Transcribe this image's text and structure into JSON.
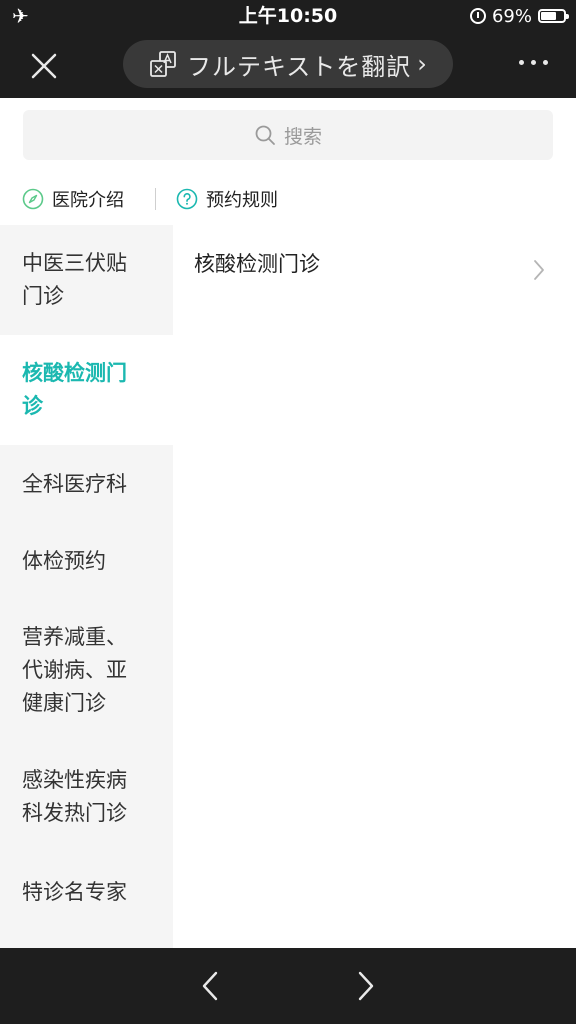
{
  "status_bar": {
    "time": "上午10:50",
    "battery": "69%",
    "battery_level": 0.69
  },
  "nav": {
    "translate_label": "フルテキストを翻訳",
    "translate_chevron": "›"
  },
  "search": {
    "placeholder": "搜索"
  },
  "links": {
    "hospital_intro": "医院介绍",
    "booking_rules": "预约规则"
  },
  "sidebar": {
    "items": [
      {
        "lines": [
          "中医三伏贴",
          "门诊"
        ],
        "active": false
      },
      {
        "lines": [
          "核酸检测门",
          "诊"
        ],
        "active": true
      },
      {
        "lines": [
          "全科医疗科"
        ],
        "active": false
      },
      {
        "lines": [
          "体检预约"
        ],
        "active": false
      },
      {
        "lines": [
          "营养减重、",
          "代谢病、亚",
          "健康门诊"
        ],
        "active": false
      },
      {
        "lines": [
          "感染性疾病",
          "科发热门诊"
        ],
        "active": false
      },
      {
        "lines": [
          "特诊名专家"
        ],
        "active": false
      }
    ]
  },
  "content": {
    "items": [
      {
        "label": "核酸检测门诊"
      }
    ]
  },
  "colors": {
    "accent": "#1bb8b0",
    "dark_bar": "#1e1e1e",
    "sidebar_bg": "#f5f5f5"
  }
}
